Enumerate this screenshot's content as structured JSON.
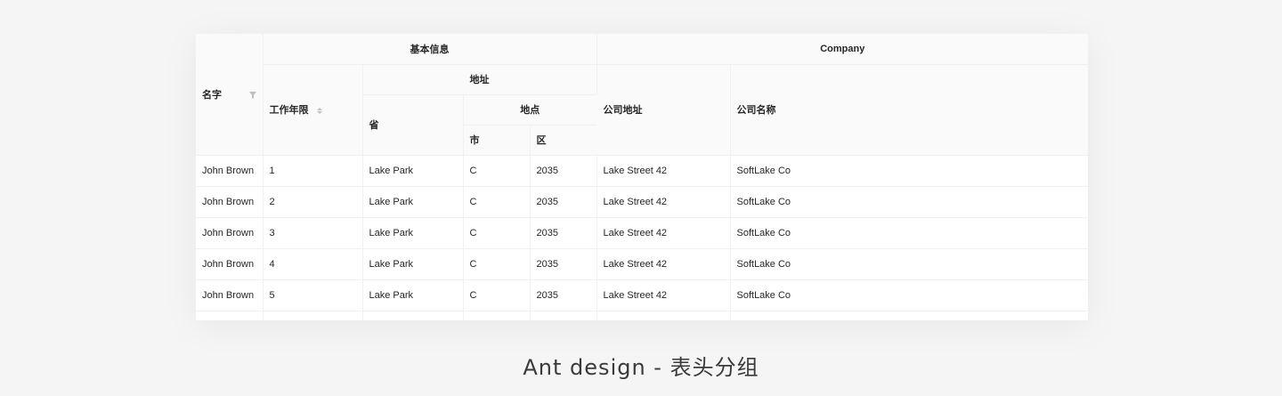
{
  "header": {
    "name": "名字",
    "basic_info": "基本信息",
    "company": "Company",
    "address": "地址",
    "work_years": "工作年限",
    "province": "省",
    "location": "地点",
    "city": "市",
    "district": "区",
    "company_address": "公司地址",
    "company_name": "公司名称"
  },
  "rows": [
    {
      "name": "John Brown",
      "years": "1",
      "province": "Lake Park",
      "city": "C",
      "district": "2035",
      "company_address": "Lake Street 42",
      "company_name": "SoftLake Co"
    },
    {
      "name": "John Brown",
      "years": "2",
      "province": "Lake Park",
      "city": "C",
      "district": "2035",
      "company_address": "Lake Street 42",
      "company_name": "SoftLake Co"
    },
    {
      "name": "John Brown",
      "years": "3",
      "province": "Lake Park",
      "city": "C",
      "district": "2035",
      "company_address": "Lake Street 42",
      "company_name": "SoftLake Co"
    },
    {
      "name": "John Brown",
      "years": "4",
      "province": "Lake Park",
      "city": "C",
      "district": "2035",
      "company_address": "Lake Street 42",
      "company_name": "SoftLake Co"
    },
    {
      "name": "John Brown",
      "years": "5",
      "province": "Lake Park",
      "city": "C",
      "district": "2035",
      "company_address": "Lake Street 42",
      "company_name": "SoftLake Co"
    }
  ],
  "caption": "Ant design - 表头分组",
  "icons": {
    "filter": "filter-icon",
    "sort": "sort-icon"
  },
  "colors": {
    "header_bg": "#fafafa",
    "border": "#f0f0f0",
    "icon": "#bfbfbf",
    "page_bg": "#f5f5f5"
  }
}
